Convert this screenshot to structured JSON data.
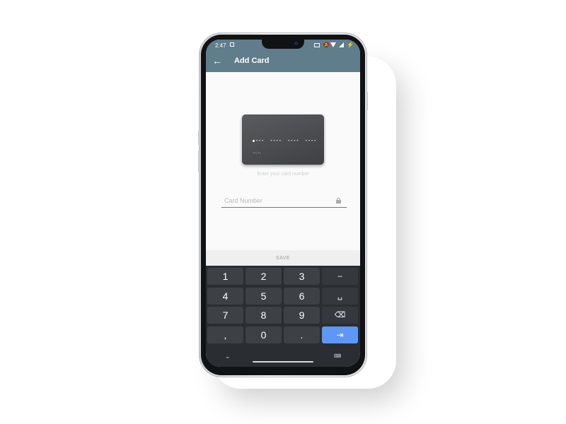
{
  "status_bar": {
    "time": "2:47",
    "icons": [
      "gallery-icon",
      "vibrate-icon",
      "mute-icon",
      "wifi-icon",
      "signal-icon",
      "charging-icon"
    ]
  },
  "app_bar": {
    "title": "Add Card",
    "back_icon": "←"
  },
  "card_preview": {
    "number_mask": "••••  ••••  ••••  ••••",
    "expiry_mask": "••/••"
  },
  "hint_text": "Enter your card number",
  "card_input": {
    "value": "",
    "placeholder": "Card Number"
  },
  "save_button": {
    "label": "SAVE"
  },
  "keyboard": {
    "keys": [
      [
        "1",
        "2",
        "3",
        "–"
      ],
      [
        "4",
        "5",
        "6",
        "␣"
      ],
      [
        "7",
        "8",
        "9",
        "⌫"
      ],
      [
        ",",
        "0",
        ".",
        "⇥"
      ]
    ],
    "hide_icon": "⌄",
    "switch_icon": "⌨"
  },
  "colors": {
    "app_bar": "#607d8b",
    "keyboard_bg": "#2a2e32",
    "key_bg": "#3d4145",
    "enter_key": "#5e97f6"
  }
}
